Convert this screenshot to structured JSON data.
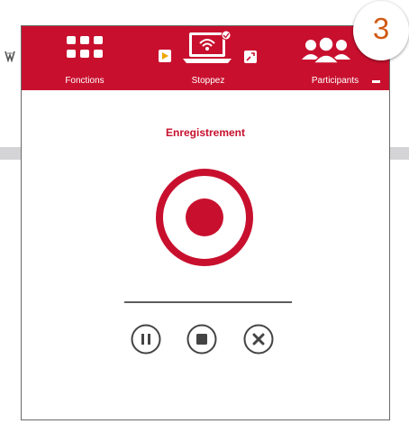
{
  "toolbar": {
    "functions_label": "Fonctions",
    "stop_label": "Stoppez",
    "participants_label": "Participants"
  },
  "badge": {
    "value": "3"
  },
  "recording": {
    "title": "Enregistrement"
  },
  "colors": {
    "accent": "#c8102e",
    "badge_text": "#d05a14"
  },
  "icons": {
    "functions": "grid-icon",
    "stop": "laptop-wifi-icon",
    "participants": "people-icon",
    "record": "record-icon",
    "pause": "pause-icon",
    "stop_control": "stop-icon",
    "cancel": "close-icon"
  }
}
